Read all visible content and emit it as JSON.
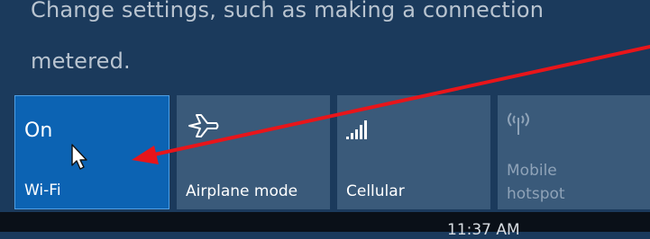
{
  "settings_text": {
    "line1": "Change settings, such as making a connection",
    "line2": "metered."
  },
  "tiles": [
    {
      "state": "On",
      "label": "Wi-Fi",
      "icon": "wifi-icon",
      "active": true
    },
    {
      "label": "Airplane mode",
      "icon": "airplane-icon"
    },
    {
      "label": "Cellular",
      "icon": "cellular-signal-icon"
    },
    {
      "label_line1": "Mobile",
      "label_line2": "hotspot",
      "icon": "mobile-hotspot-icon",
      "disabled": true
    }
  ],
  "taskbar": {
    "clock": "11:37 AM"
  },
  "colors": {
    "panel_bg": "#1b3a5c",
    "active_tile": "#0c63b3",
    "inactive_tile": "#3a5a7a",
    "annotation_arrow": "#e8151a"
  }
}
